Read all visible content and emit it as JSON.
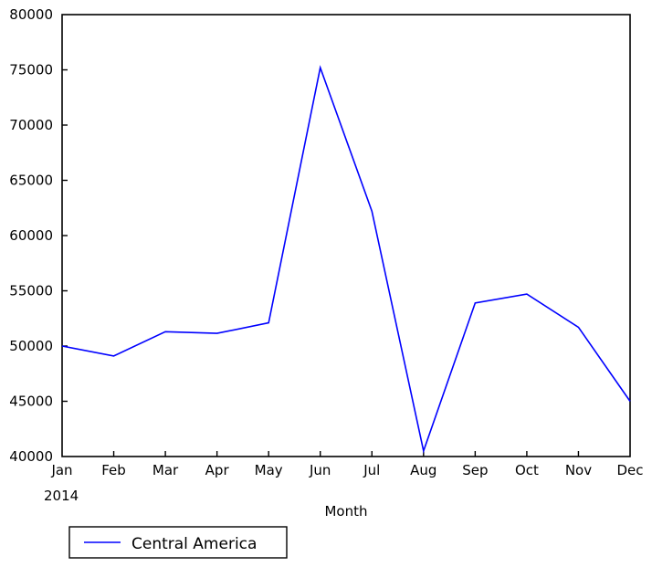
{
  "chart_data": {
    "type": "line",
    "title": "",
    "xlabel": "Month",
    "ylabel": "",
    "categories": [
      "Jan",
      "Feb",
      "Mar",
      "Apr",
      "May",
      "Jun",
      "Jul",
      "Aug",
      "Sep",
      "Oct",
      "Nov",
      "Dec"
    ],
    "x_secondary_label": "2014",
    "series": [
      {
        "name": "Central America",
        "color": "#0000ff",
        "values": [
          50000,
          49100,
          51300,
          51150,
          52100,
          75200,
          62200,
          40500,
          53900,
          54700,
          51700,
          45000
        ]
      }
    ],
    "ylim": [
      40000,
      80000
    ],
    "y_ticks": [
      "40000",
      "45000",
      "50000",
      "55000",
      "60000",
      "65000",
      "70000",
      "75000",
      "80000"
    ],
    "y_tick_values": [
      40000,
      45000,
      50000,
      55000,
      60000,
      65000,
      70000,
      75000,
      80000
    ],
    "grid": false,
    "legend_position": "below-axes-left",
    "legend_entries": [
      "Central America"
    ]
  },
  "figure": {
    "background_color": "#ffffff",
    "frame_color": "#000000"
  }
}
